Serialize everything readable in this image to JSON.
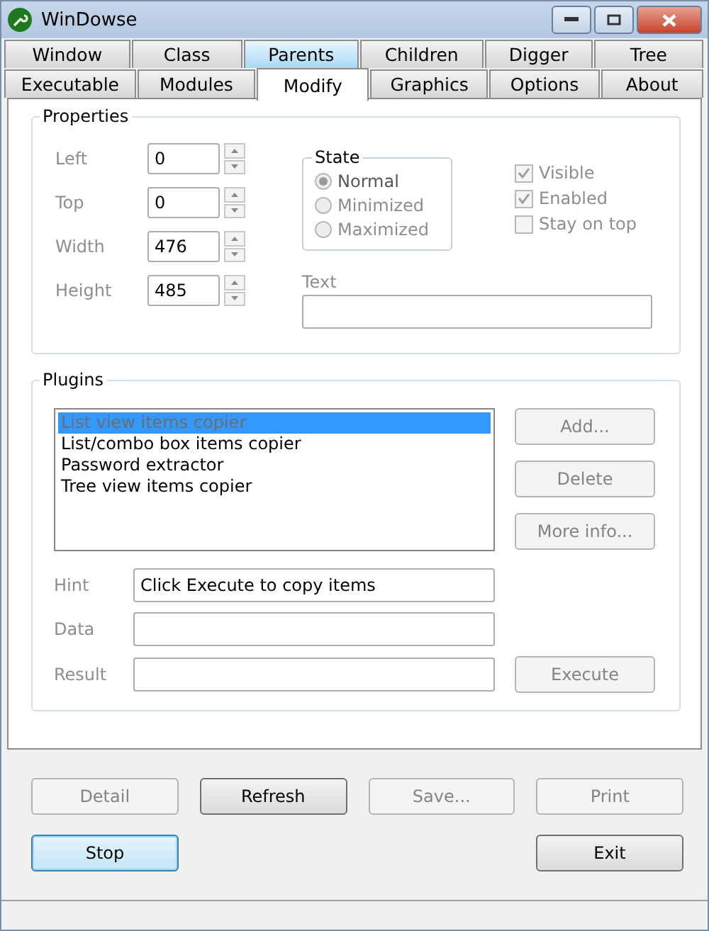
{
  "window": {
    "title": "WinDowse"
  },
  "tab_rows": [
    [
      {
        "label": "Window",
        "selected": false,
        "highlighted": false
      },
      {
        "label": "Class",
        "selected": false,
        "highlighted": false
      },
      {
        "label": "Parents",
        "selected": false,
        "highlighted": true
      },
      {
        "label": "Children",
        "selected": false,
        "highlighted": false
      },
      {
        "label": "Digger",
        "selected": false,
        "highlighted": false
      },
      {
        "label": "Tree",
        "selected": false,
        "highlighted": false
      }
    ],
    [
      {
        "label": "Executable",
        "selected": false,
        "highlighted": false
      },
      {
        "label": "Modules",
        "selected": false,
        "highlighted": false
      },
      {
        "label": "Modify",
        "selected": true,
        "highlighted": false
      },
      {
        "label": "Graphics",
        "selected": false,
        "highlighted": false
      },
      {
        "label": "Options",
        "selected": false,
        "highlighted": false
      },
      {
        "label": "About",
        "selected": false,
        "highlighted": false
      }
    ]
  ],
  "properties": {
    "title": "Properties",
    "fields": [
      {
        "label": "Left",
        "value": "0"
      },
      {
        "label": "Top",
        "value": "0"
      },
      {
        "label": "Width",
        "value": "476"
      },
      {
        "label": "Height",
        "value": "485"
      }
    ],
    "state": {
      "title": "State",
      "options": [
        {
          "label": "Normal",
          "selected": true
        },
        {
          "label": "Minimized",
          "selected": false
        },
        {
          "label": "Maximized",
          "selected": false
        }
      ]
    },
    "checkboxes": [
      {
        "label": "Visible",
        "checked": true
      },
      {
        "label": "Enabled",
        "checked": true
      },
      {
        "label": "Stay on top",
        "checked": false
      }
    ],
    "text_label": "Text"
  },
  "plugins": {
    "title": "Plugins",
    "items": [
      {
        "label": "List view items copier",
        "selected": true
      },
      {
        "label": "List/combo box items copier",
        "selected": false
      },
      {
        "label": "Password extractor",
        "selected": false
      },
      {
        "label": "Tree view items copier",
        "selected": false
      }
    ],
    "side_buttons": [
      {
        "label": "Add...",
        "disabled": true
      },
      {
        "label": "Delete",
        "disabled": true
      },
      {
        "label": "More info...",
        "disabled": true
      }
    ],
    "fields": [
      {
        "label": "Hint",
        "value": "Click Execute to copy items"
      },
      {
        "label": "Data"
      },
      {
        "label": "Result"
      }
    ],
    "execute": {
      "label": "Execute",
      "disabled": true
    }
  },
  "bottom_buttons": [
    [
      {
        "label": "Detail",
        "disabled": true,
        "default": false
      },
      {
        "label": "Refresh",
        "disabled": false,
        "default": false
      },
      {
        "label": "Save...",
        "disabled": true,
        "default": false
      },
      {
        "label": "Print",
        "disabled": true,
        "default": false
      }
    ],
    [
      {
        "label": "Stop",
        "disabled": false,
        "default": true
      },
      {
        "label": "Exit",
        "disabled": false,
        "default": false
      }
    ]
  ]
}
